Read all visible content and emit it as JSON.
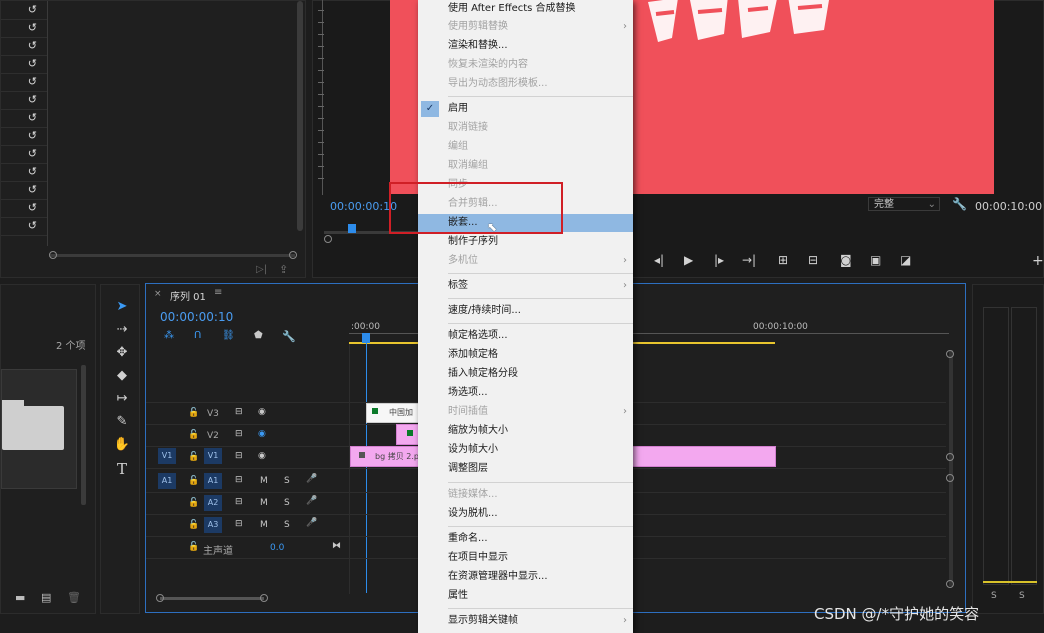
{
  "project_panel": {
    "items_count": "2 个项"
  },
  "program_monitor": {
    "timecode": "00:00:00:10",
    "quality": "完整",
    "duration": "00:00:10:00"
  },
  "timeline": {
    "sequence_tab": "序列 01",
    "timecode": "00:00:00:10",
    "ruler_start": ":00:00",
    "ruler_end": "00:00:10:00",
    "tracks": {
      "v3": "V3",
      "v2": "V2",
      "v1": "V1",
      "v1_source": "V1",
      "a1": "A1",
      "a1_source": "A1",
      "a2": "A2",
      "a3": "A3",
      "master": "主声道",
      "master_value": "0.0",
      "m": "M",
      "s": "S"
    },
    "clips": {
      "v3_clip": "中国加",
      "v1_clip": "bg 拷贝 2.p"
    }
  },
  "audio_meter": {
    "s_left": "S",
    "s_right": "S"
  },
  "context_menu": {
    "items": [
      {
        "label": "使用 After Effects 合成替换",
        "disabled": false
      },
      {
        "label": "使用剪辑替换",
        "disabled": true,
        "submenu": true
      },
      {
        "label": "渲染和替换...",
        "disabled": false
      },
      {
        "label": "恢复未渲染的内容",
        "disabled": true
      },
      {
        "label": "导出为动态图形模板...",
        "disabled": true
      },
      {
        "label": "启用",
        "disabled": false,
        "checked": true
      },
      {
        "label": "取消链接",
        "disabled": true
      },
      {
        "label": "编组",
        "disabled": true
      },
      {
        "label": "取消编组",
        "disabled": true
      },
      {
        "label": "同步",
        "disabled": true
      },
      {
        "label": "合并剪辑...",
        "disabled": true
      },
      {
        "label": "嵌套...",
        "disabled": false,
        "highlighted": true
      },
      {
        "label": "制作子序列",
        "disabled": false
      },
      {
        "label": "多机位",
        "disabled": true,
        "submenu": true
      },
      {
        "label": "标签",
        "disabled": false,
        "submenu": true
      },
      {
        "label": "速度/持续时间...",
        "disabled": false
      },
      {
        "label": "帧定格选项...",
        "disabled": false
      },
      {
        "label": "添加帧定格",
        "disabled": false
      },
      {
        "label": "插入帧定格分段",
        "disabled": false
      },
      {
        "label": "场选项...",
        "disabled": false
      },
      {
        "label": "时间插值",
        "disabled": true,
        "submenu": true
      },
      {
        "label": "缩放为帧大小",
        "disabled": false
      },
      {
        "label": "设为帧大小",
        "disabled": false
      },
      {
        "label": "调整图层",
        "disabled": false
      },
      {
        "label": "链接媒体...",
        "disabled": true
      },
      {
        "label": "设为脱机...",
        "disabled": false
      },
      {
        "label": "重命名...",
        "disabled": false
      },
      {
        "label": "在项目中显示",
        "disabled": false
      },
      {
        "label": "在资源管理器中显示...",
        "disabled": false
      },
      {
        "label": "属性",
        "disabled": false
      },
      {
        "label": "显示剪辑关键帧",
        "disabled": false,
        "submenu": true
      }
    ]
  },
  "watermark": "CSDN @/*守护她的笑容",
  "colors": {
    "accent_blue": "#2d8ceb",
    "highlight": "#8fb8e2",
    "annotation_red": "#d01f26",
    "monitor_pink": "#f0505a",
    "clip_pink": "#f3a8ef"
  }
}
